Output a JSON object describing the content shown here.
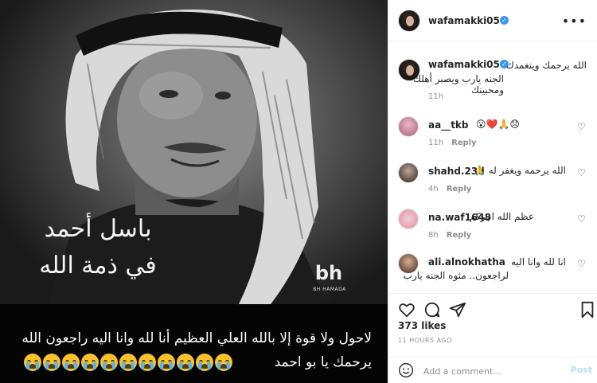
{
  "photo": {
    "overlay_name": "باسل أحمد",
    "overlay_sub": "في ذمة الله",
    "logo_mark": "bh",
    "logo_text": "BH HAMADA",
    "caption_line1": "لاحول ولا قوة إلا بالله العلي العظيم أنا لله وانا اليه راجعون الله",
    "caption_line2": "يرحمك يا بو احمد",
    "caption_emoji_count": 11
  },
  "header": {
    "username": "wafamakki05",
    "verified": true,
    "more_label": "•••"
  },
  "caption_comment": {
    "username": "wafamakki05",
    "text_line1": "الله يرحمك ويتغمدك",
    "text_line2": "الجنه يارب ويصبر أهلك ومحبينك",
    "time": "11h"
  },
  "comments": [
    {
      "username": "aa__tkb",
      "text": "😮❤️🙏😞",
      "time": "11h",
      "reply_label": "Reply"
    },
    {
      "username": "shahd.23d",
      "text": "الله يرحمه ويغفر له 🙏",
      "time": "4h",
      "reply_label": "Reply"
    },
    {
      "username": "na.waf1648",
      "text": "عظم الله اجركم",
      "time": "8h",
      "reply_label": "Reply"
    },
    {
      "username": "ali.alnokhatha",
      "text": "انا لله وانا اليه",
      "text_line2": "لراجعون.. مثوه الجنه يارب",
      "time": "",
      "reply_label": ""
    }
  ],
  "likes": "373 likes",
  "time_ago": "11 HOURS AGO",
  "add_comment": {
    "placeholder": "Add a comment...",
    "post_label": "Post"
  },
  "colors": {
    "verified": "#3897f0",
    "post_disabled": "#b2dffc",
    "meta": "#8e8e8e"
  },
  "icons": [
    "heart-icon",
    "comment-icon",
    "share-icon",
    "bookmark-icon",
    "emoji-icon"
  ]
}
